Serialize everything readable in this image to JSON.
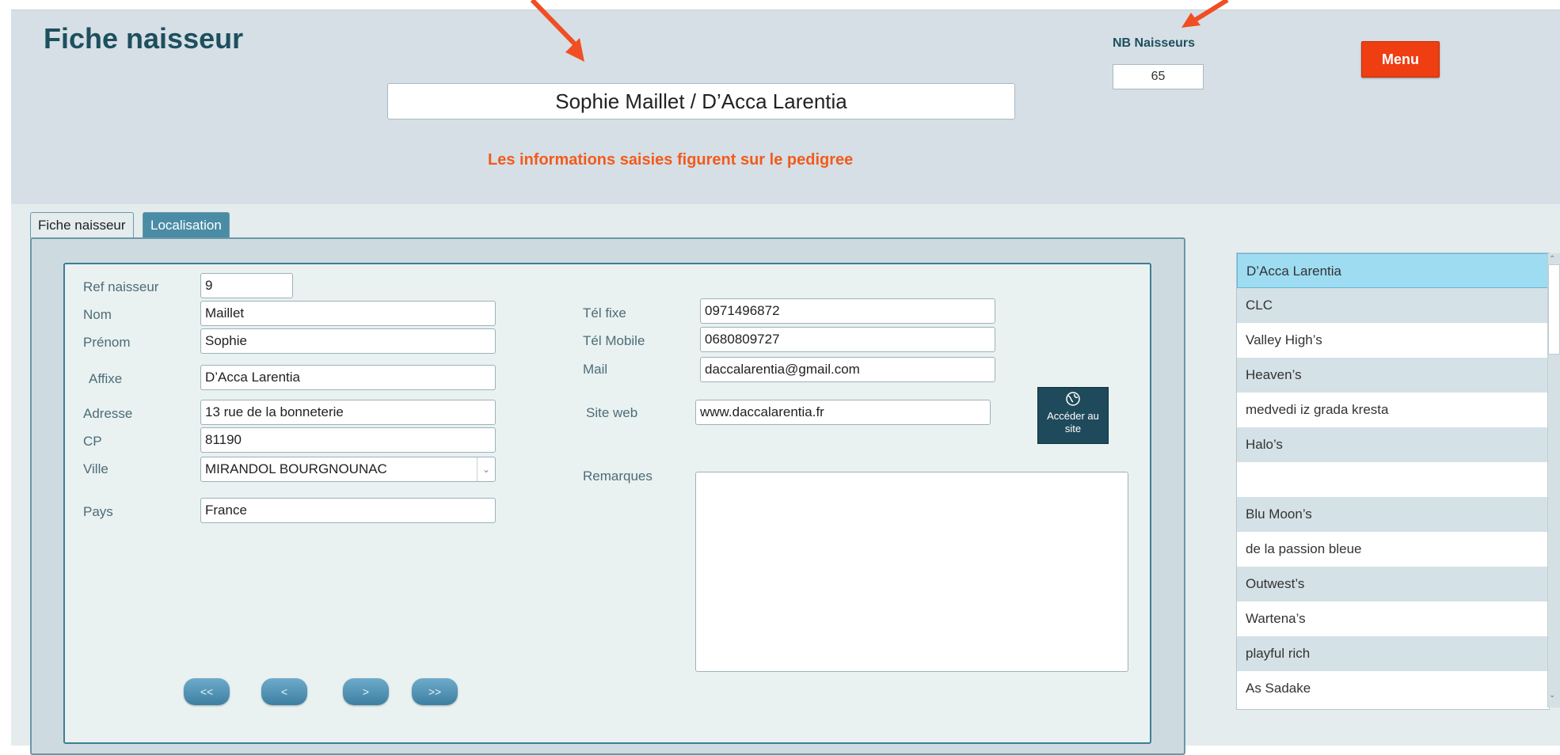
{
  "header": {
    "title": "Fiche naisseur",
    "breeder_banner": "Sophie Maillet / D’Acca Larentia",
    "notice": "Les informations saisies figurent sur le pedigree",
    "nb_label": "NB Naisseurs",
    "nb_value": "65",
    "menu_label": "Menu"
  },
  "tabs": [
    {
      "label": "Fiche naisseur",
      "active": true
    },
    {
      "label": "Localisation",
      "active": false
    }
  ],
  "form": {
    "ref": {
      "label": "Ref naisseur",
      "value": "9"
    },
    "nom": {
      "label": "Nom",
      "value": "Maillet"
    },
    "prenom": {
      "label": "Prénom",
      "value": "Sophie"
    },
    "affixe": {
      "label": "Affixe",
      "value": "D’Acca Larentia"
    },
    "adresse": {
      "label": "Adresse",
      "value": "13 rue de la bonneterie"
    },
    "cp": {
      "label": "CP",
      "value": "81190"
    },
    "ville": {
      "label": "Ville",
      "value": "MIRANDOL BOURGNOUNAC"
    },
    "pays": {
      "label": "Pays",
      "value": "France"
    },
    "tel_fixe": {
      "label": "Tél fixe",
      "value": "0971496872"
    },
    "tel_mobile": {
      "label": "Tél Mobile",
      "value": "0680809727"
    },
    "mail": {
      "label": "Mail",
      "value": "daccalarentia@gmail.com"
    },
    "site_web": {
      "label": "Site web",
      "value": "www.daccalarentia.fr"
    },
    "remarques": {
      "label": "Remarques",
      "value": ""
    },
    "web_button_line1": "Accéder au",
    "web_button_line2": "site"
  },
  "nav": {
    "first": "<<",
    "prev": "<",
    "next": ">",
    "last": ">>"
  },
  "list": {
    "items": [
      "D’Acca Larentia",
      "CLC",
      "Valley High’s",
      "Heaven’s",
      "medvedi iz grada kresta",
      "Halo’s",
      "",
      "Blu Moon’s",
      "de la passion bleue",
      "Outwest’s",
      "Wartena’s",
      "playful rich",
      "As Sadake"
    ],
    "selected_index": 0
  },
  "colors": {
    "accent_red": "#ee3e12",
    "notice_orange": "#f25b1d",
    "title_teal": "#1d4f5f",
    "selected_row": "#9edcf2"
  },
  "icons": {
    "web_button": "globe-icon"
  }
}
